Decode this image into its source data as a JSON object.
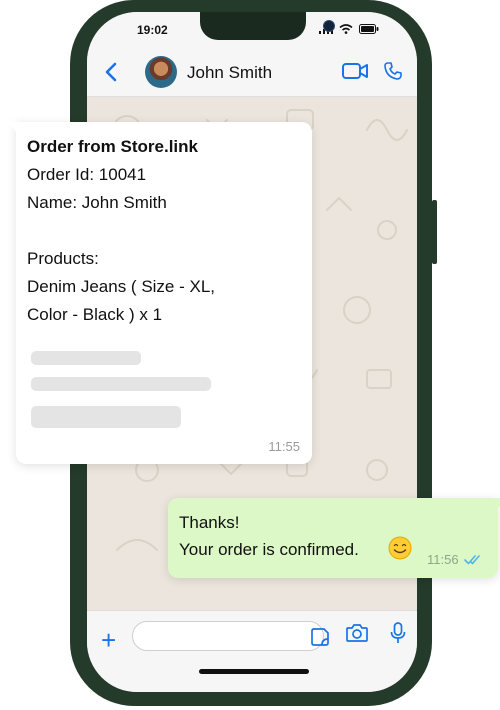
{
  "status_bar": {
    "time": "19:02"
  },
  "header": {
    "contact_name": "John Smith"
  },
  "messages": {
    "incoming": {
      "title": "Order from Store.link",
      "lines": [
        "Order Id: 10041",
        "Name: John Smith",
        "",
        "Products:",
        "Denim Jeans ( Size - XL,",
        "Color - Black ) x 1"
      ],
      "time": "11:55"
    },
    "outgoing": {
      "line1": "Thanks!",
      "line2": "Your order is confirmed.",
      "time": "11:56"
    }
  },
  "colors": {
    "accent": "#1a73e8",
    "outgoing_bubble": "#dcf8c6",
    "phone_frame": "#243a2a",
    "read_ticks": "#4fb6ec"
  },
  "icons": [
    "back-chevron-icon",
    "video-call-icon",
    "phone-call-icon",
    "plus-icon",
    "sticker-icon",
    "camera-icon",
    "mic-icon",
    "signal-icon",
    "wifi-icon",
    "battery-icon",
    "smile-emoji-icon",
    "double-check-icon"
  ]
}
